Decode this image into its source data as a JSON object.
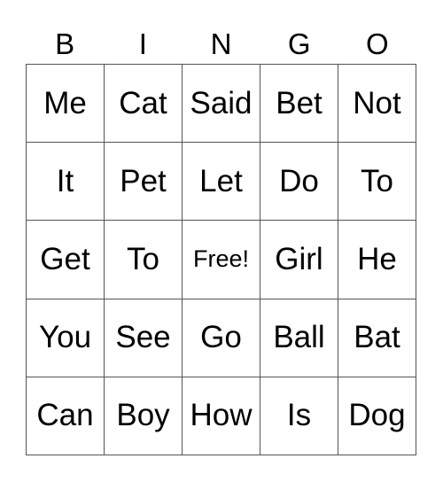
{
  "header": [
    "B",
    "I",
    "N",
    "G",
    "O"
  ],
  "cells": [
    [
      "Me",
      "Cat",
      "Said",
      "Bet",
      "Not"
    ],
    [
      "It",
      "Pet",
      "Let",
      "Do",
      "To"
    ],
    [
      "Get",
      "To",
      "Free!",
      "Girl",
      "He"
    ],
    [
      "You",
      "See",
      "Go",
      "Ball",
      "Bat"
    ],
    [
      "Can",
      "Boy",
      "How",
      "Is",
      "Dog"
    ]
  ],
  "colors": {
    "grid_line": "#555555",
    "text": "#000000",
    "background": "#ffffff"
  }
}
